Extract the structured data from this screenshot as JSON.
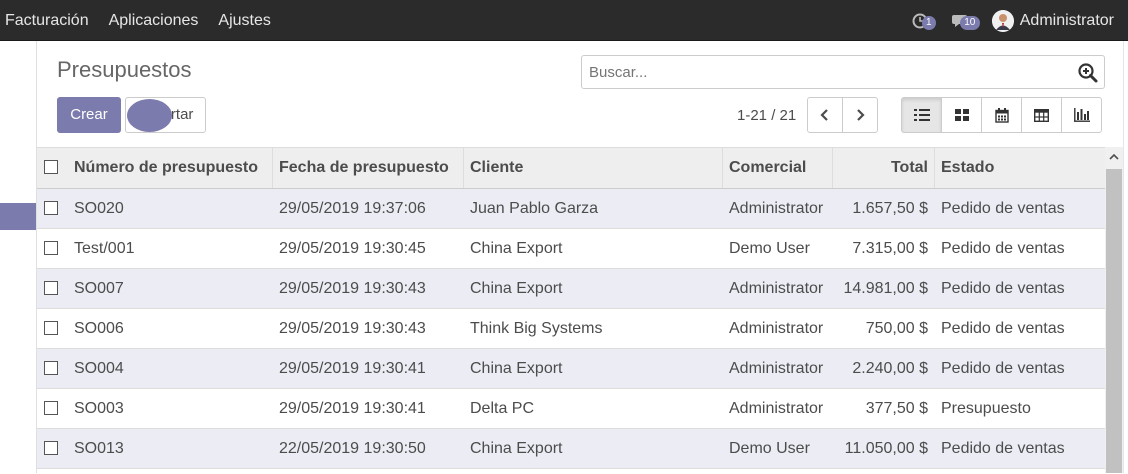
{
  "nav": {
    "menu": [
      "Facturación",
      "Aplicaciones",
      "Ajustes"
    ],
    "activity_count": "1",
    "messages_count": "10",
    "user_name": "Administrator"
  },
  "control": {
    "title": "Presupuestos",
    "create_label": "Crear",
    "import_label": "Importar",
    "search_placeholder": "Buscar...",
    "pager": "1-21 / 21"
  },
  "colors": {
    "accent": "#7c7bad",
    "navbar": "#2b2b2b",
    "row_alt": "#ececf5"
  },
  "table": {
    "columns": [
      "Número de presupuesto",
      "Fecha de presupuesto",
      "Cliente",
      "Comercial",
      "Total",
      "Estado"
    ],
    "rows": [
      {
        "number": "SO020",
        "date": "29/05/2019 19:37:06",
        "client": "Juan Pablo Garza",
        "salesperson": "Administrator",
        "total": "1.657,50 $",
        "status": "Pedido de ventas"
      },
      {
        "number": "Test/001",
        "date": "29/05/2019 19:30:45",
        "client": "China Export",
        "salesperson": "Demo User",
        "total": "7.315,00 $",
        "status": "Pedido de ventas"
      },
      {
        "number": "SO007",
        "date": "29/05/2019 19:30:43",
        "client": "China Export",
        "salesperson": "Administrator",
        "total": "14.981,00 $",
        "status": "Pedido de ventas"
      },
      {
        "number": "SO006",
        "date": "29/05/2019 19:30:43",
        "client": "Think Big Systems",
        "salesperson": "Administrator",
        "total": "750,00 $",
        "status": "Pedido de ventas"
      },
      {
        "number": "SO004",
        "date": "29/05/2019 19:30:41",
        "client": "China Export",
        "salesperson": "Administrator",
        "total": "2.240,00 $",
        "status": "Pedido de ventas"
      },
      {
        "number": "SO003",
        "date": "29/05/2019 19:30:41",
        "client": "Delta PC",
        "salesperson": "Administrator",
        "total": "377,50 $",
        "status": "Presupuesto"
      },
      {
        "number": "SO013",
        "date": "22/05/2019 19:30:50",
        "client": "China Export",
        "salesperson": "Demo User",
        "total": "11.050,00 $",
        "status": "Pedido de ventas"
      }
    ]
  }
}
